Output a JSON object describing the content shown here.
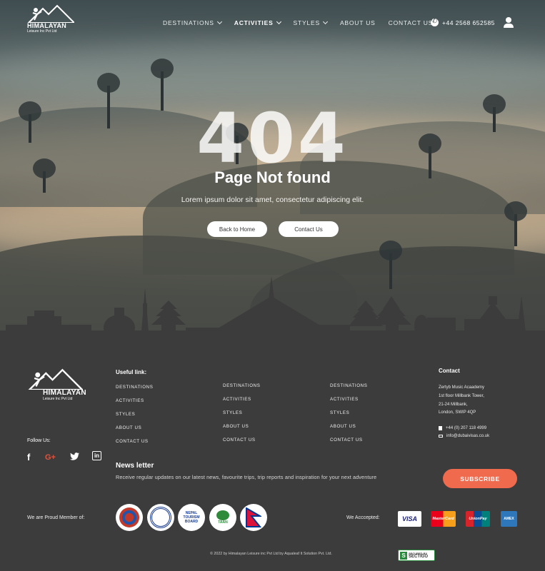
{
  "brand": {
    "name": "HIMALAYAN",
    "subtitle": "Leisure Inc Pvt Ltd"
  },
  "nav": {
    "items": [
      {
        "label": "DESTINATIONS",
        "dropdown": true,
        "active": false
      },
      {
        "label": "ACTIVITIES",
        "dropdown": true,
        "active": true
      },
      {
        "label": "STYLES",
        "dropdown": true,
        "active": false
      },
      {
        "label": "ABOUT US",
        "dropdown": false,
        "active": false
      },
      {
        "label": "CONTACT US",
        "dropdown": false,
        "active": false
      }
    ],
    "phone": "+44 2568 652585"
  },
  "hero": {
    "code": "404",
    "title": "Page Not  found",
    "subtitle": "Lorem ipsum dolor sit amet, consectetur adipiscing elit.",
    "back_home": "Back to Home",
    "contact": "Contact Us"
  },
  "footer": {
    "useful_title": "Useful link:",
    "col1": [
      "DESTINATIONS",
      "ACTIVITIES",
      "STYLES",
      "ABOUT US",
      "CONTACT US"
    ],
    "col2": [
      "DESTINATIONS",
      "ACTIVITIES",
      "STYLES",
      "ABOUT US",
      "CONTACT US"
    ],
    "col3": [
      "DESTINATIONS",
      "ACTIVITIES",
      "STYLES",
      "ABOUT US",
      "CONTACT US"
    ],
    "contact_title": "Contact",
    "address": [
      "Zertyb Music Acaademy",
      "1st floor Millbank Tower,",
      "21-24 Millbank,",
      "London, SWIP 4QP"
    ],
    "phone": "+44 (0) 207 118 4999",
    "email": "info@dubaivisas.co.uk",
    "follow": "Follow Us:",
    "social": {
      "facebook": "f",
      "google": "G+",
      "twitter": "🐦",
      "linkedin": "in"
    },
    "newsletter_title": "News letter",
    "newsletter_text": "Receive regular updates on our latest news, favourite trips, trip reports and inspiration for your next adventure",
    "subscribe": "SUBSCRIBE",
    "member_label": "We are Proud Member of:",
    "accepted_label": "We Acccepted:",
    "badge_ntb": "NEPAL TOURISM BOARD",
    "badge_taan": "TAAN",
    "cards": {
      "visa": "VISA",
      "mastercard": "MasterCard",
      "unionpay": "UnionPay",
      "amex": "AMEX"
    },
    "copyright": "© 2022 by Himalayan Leisure inc Pvt Ltd by Aqualeaf It Solution Pvt. Ltd.",
    "sectigo": [
      "SECURED BY",
      "SECTIGO"
    ]
  },
  "colors": {
    "accent": "#f06a4e",
    "footer_bg": "#3c3c3c",
    "visa_blue": "#1a1f71"
  }
}
